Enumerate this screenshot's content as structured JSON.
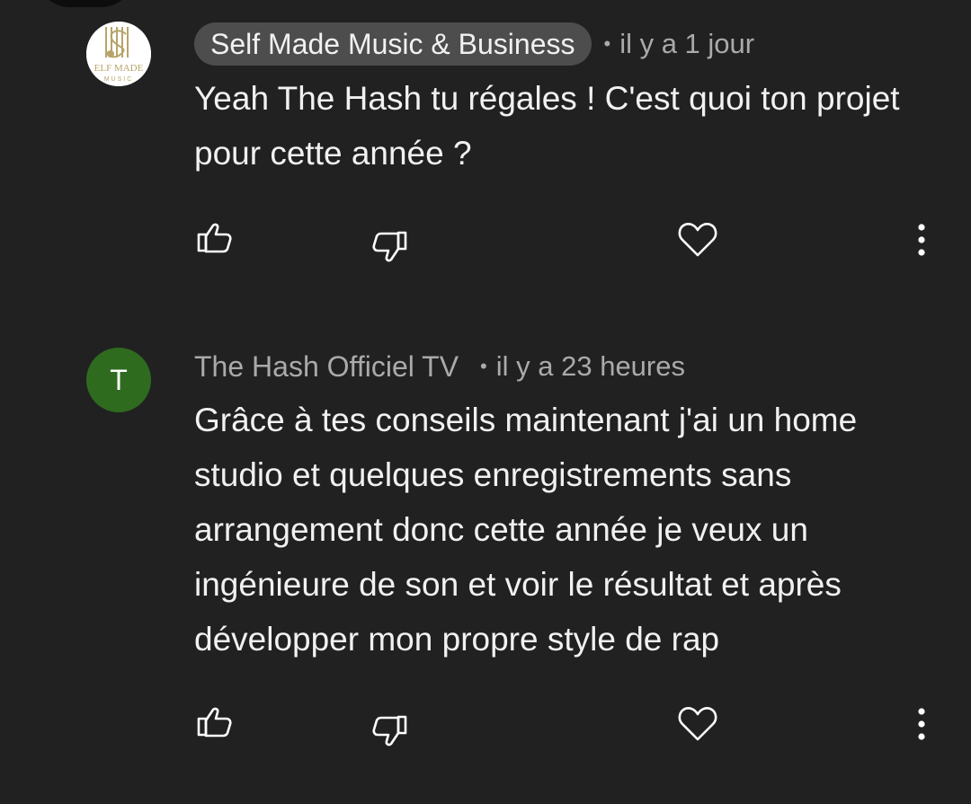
{
  "comments": [
    {
      "author": "Self Made Music & Business",
      "author_highlighted": true,
      "avatar_text": "ELF MADE",
      "avatar_subtext": "MUSIC",
      "time": "il y a 1 jour",
      "text": "Yeah The Hash tu régales ! C'est quoi ton projet pour cette année ?"
    },
    {
      "author": "The Hash Officiel TV",
      "author_highlighted": false,
      "avatar_letter": "T",
      "avatar_color": "#2e6b1f",
      "time": "il y a 23 heures",
      "text": "Grâce à tes conseils maintenant j'ai un home studio et quelques enregistrements sans arrangement donc cette année je veux un ingénieure de son et voir le résultat et après développer mon propre style de rap"
    }
  ],
  "icons": {
    "like": "thumbs-up-icon",
    "dislike": "thumbs-down-icon",
    "heart": "heart-icon",
    "more": "more-vertical-icon"
  },
  "colors": {
    "background": "#212121",
    "pill": "#4d4d4d",
    "secondary_text": "#aaaaaa",
    "primary_text": "#f1f1f1"
  }
}
